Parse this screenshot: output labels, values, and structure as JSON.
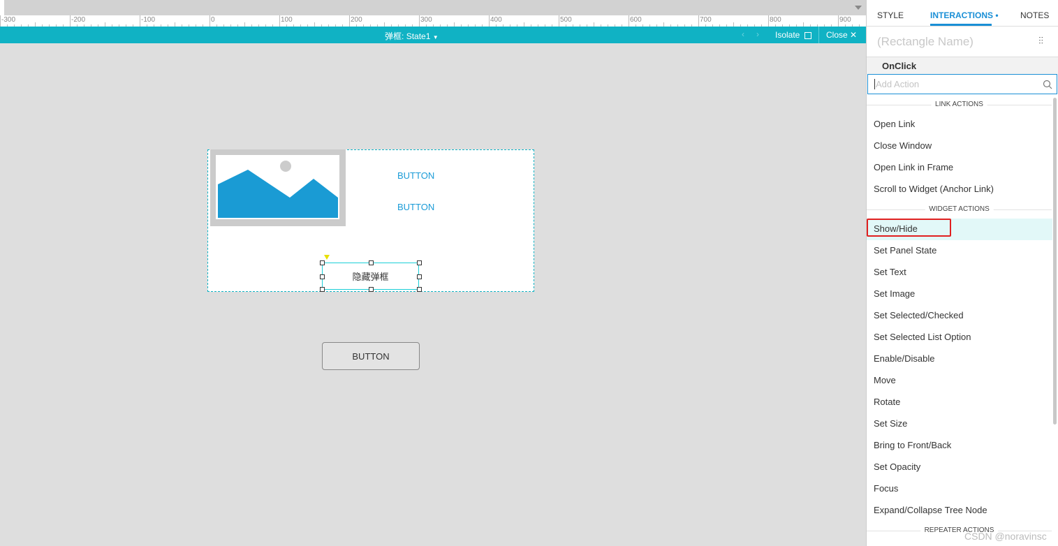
{
  "ruler": {
    "labels": [
      "-300",
      "-200",
      "-100",
      "0",
      "100",
      "200",
      "300",
      "400",
      "500",
      "600",
      "700",
      "800",
      "900"
    ]
  },
  "statebar": {
    "panel_name": "弹框:",
    "state": "State1",
    "isolate": "Isolate",
    "close": "Close"
  },
  "canvas": {
    "button1": "BUTTON",
    "button2": "BUTTON",
    "selected_label": "隐藏弹框",
    "button3": "BUTTON"
  },
  "right_panel": {
    "tabs": [
      {
        "label": "STYLE"
      },
      {
        "label": "INTERACTIONS",
        "active": true
      },
      {
        "label": "NOTES"
      }
    ],
    "name_placeholder": "(Rectangle Name)",
    "event": "OnClick",
    "search_placeholder": "Add Action",
    "sections": [
      {
        "title": "LINK ACTIONS",
        "items": [
          "Open Link",
          "Close Window",
          "Open Link in Frame",
          "Scroll to Widget (Anchor Link)"
        ]
      },
      {
        "title": "WIDGET ACTIONS",
        "items": [
          "Show/Hide",
          "Set Panel State",
          "Set Text",
          "Set Image",
          "Set Selected/Checked",
          "Set Selected List Option",
          "Enable/Disable",
          "Move",
          "Rotate",
          "Set Size",
          "Bring to Front/Back",
          "Set Opacity",
          "Focus",
          "Expand/Collapse Tree Node"
        ]
      },
      {
        "title": "REPEATER ACTIONS",
        "items": []
      }
    ],
    "highlighted_item": "Show/Hide"
  },
  "watermark": "CSDN @noravinsc",
  "colors": {
    "accent": "#10b2c4",
    "tab_active": "#1a8fd6",
    "link": "#1a9bd7",
    "highlight_box": "#e02020"
  }
}
